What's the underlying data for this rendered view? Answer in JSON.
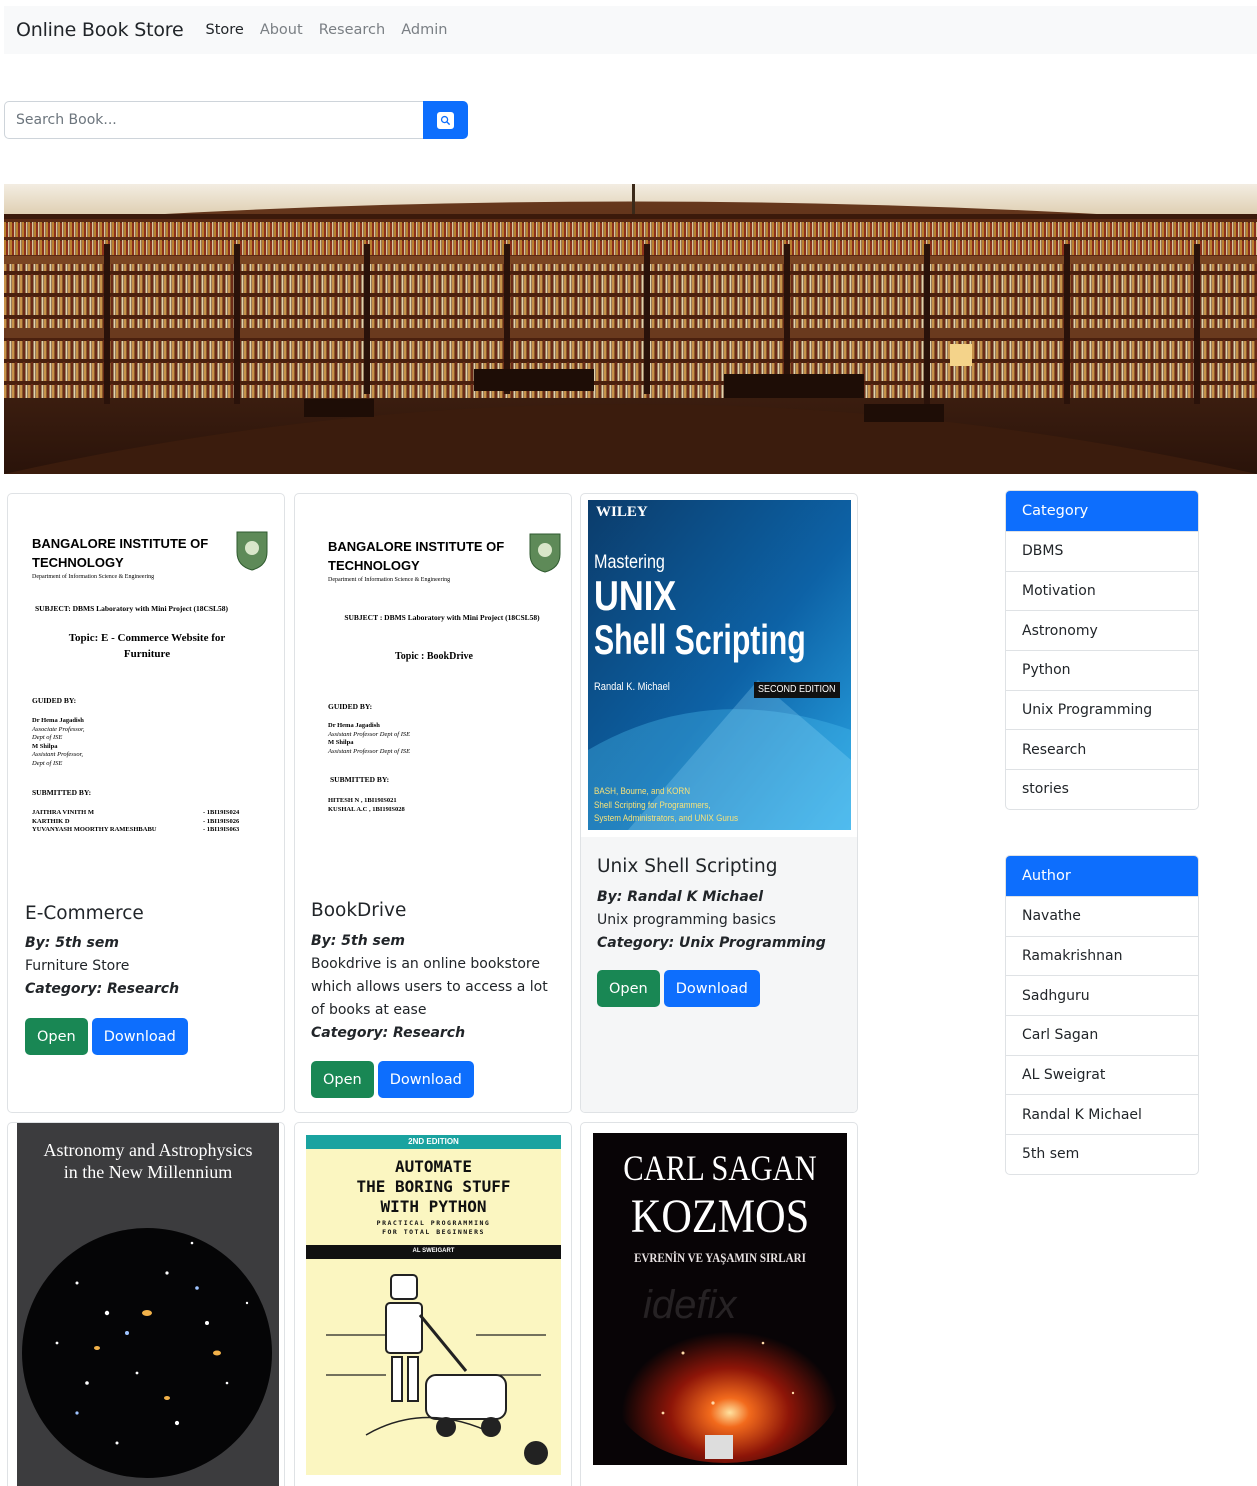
{
  "navbar": {
    "brand": "Online Book Store",
    "links": [
      "Store",
      "About",
      "Research",
      "Admin"
    ]
  },
  "search": {
    "placeholder": "Search Book...",
    "icon": "search-icon"
  },
  "colors": {
    "primary": "#0d6efd",
    "success": "#198754",
    "navbar_bg": "#f8f9fa"
  },
  "buttons": {
    "open": "Open",
    "download": "Download"
  },
  "books": [
    {
      "title": "E-Commerce",
      "author": "By: 5th sem",
      "description": "Furniture Store",
      "category": "Category: Research",
      "cover": {
        "institution": "BANGALORE INSTITUTE OF TECHNOLOGY",
        "department": "Department of Information Science & Engineering",
        "subject": "SUBJECT:   DBMS Laboratory with Mini Project (18CSL58)",
        "topic": "Topic:  E - Commerce Website for Furniture",
        "guided_by": "GUIDED BY:",
        "guides": [
          "Dr Hema Jagadish",
          "Associate Professor,",
          "Dept of ISE",
          "M Shilpa",
          "Assistant Professor,",
          "Dept of ISE"
        ],
        "submitted_by": "SUBMITTED BY:",
        "students": [
          "JAITHRA VINITH M",
          "KARTHIK D",
          "YUVANYASH MOORTHY RAMESHBABU"
        ],
        "usns": [
          "- 1BI19IS024",
          "- 1BI19IS026",
          "- 1BI19IS063"
        ]
      }
    },
    {
      "title": "BookDrive",
      "author": "By: 5th sem",
      "description": "Bookdrive is an online bookstore which allows users to access a lot of books at ease",
      "category": "Category: Research",
      "cover": {
        "institution": "BANGALORE INSTITUTE OF TECHNOLOGY",
        "department": "Department of Information Science & Engineering",
        "subject": "SUBJECT :   DBMS Laboratory with Mini Project (18CSL58)",
        "topic": "Topic :  BookDrive",
        "guided_by": "GUIDED BY:",
        "guides": [
          "Dr Hema Jagadish",
          "Assistant Professor Dept of ISE",
          "M  Shilpa",
          "Assistant Professor Dept of ISE"
        ],
        "submitted_by": "SUBMITTED BY:",
        "students": [
          "HITESH N  , 1BI19IS021",
          "KUSHAL A.C  ,  1BI19IS028"
        ]
      }
    },
    {
      "title": "Unix Shell Scripting",
      "author": "By: Randal K Michael",
      "description": "Unix programming basics",
      "category": "Category: Unix Programming",
      "cover": {
        "publisher": "WILEY",
        "line1": "Mastering",
        "line2": "UNIX",
        "line3": "Shell Scripting",
        "author": "Randal K. Michael",
        "edition": "SECOND EDITION",
        "blurb": [
          "BASH, Bourne, and KORN",
          "Shell Scripting for Programmers,",
          "System Administrators, and UNIX Gurus"
        ]
      }
    },
    {
      "cover": {
        "title_line1": "Astronomy and Astrophysics",
        "title_line2": "in the New Millennium"
      }
    },
    {
      "cover": {
        "edition": "2ND EDITION",
        "title_lines": [
          "AUTOMATE",
          "THE BORING STUFF",
          "WITH PYTHON"
        ],
        "subtitle_lines": [
          "PRACTICAL PROGRAMMING",
          "FOR TOTAL BEGINNERS"
        ],
        "author": "AL SWEIGART"
      }
    },
    {
      "cover": {
        "author": "CARL SAGAN",
        "title": "KOZMOS",
        "subtitle": "EVRENİN VE YAŞAMIN SIRLARI",
        "watermark": "idefix"
      }
    }
  ],
  "sidebar": {
    "category_header": "Category",
    "categories": [
      "DBMS",
      "Motivation",
      "Astronomy",
      "Python",
      "Unix Programming",
      "Research",
      "stories"
    ],
    "author_header": "Author",
    "authors": [
      "Navathe",
      "Ramakrishnan",
      "Sadhguru",
      "Carl Sagan",
      "AL Sweigrat",
      "Randal K Michael",
      "5th sem"
    ]
  }
}
